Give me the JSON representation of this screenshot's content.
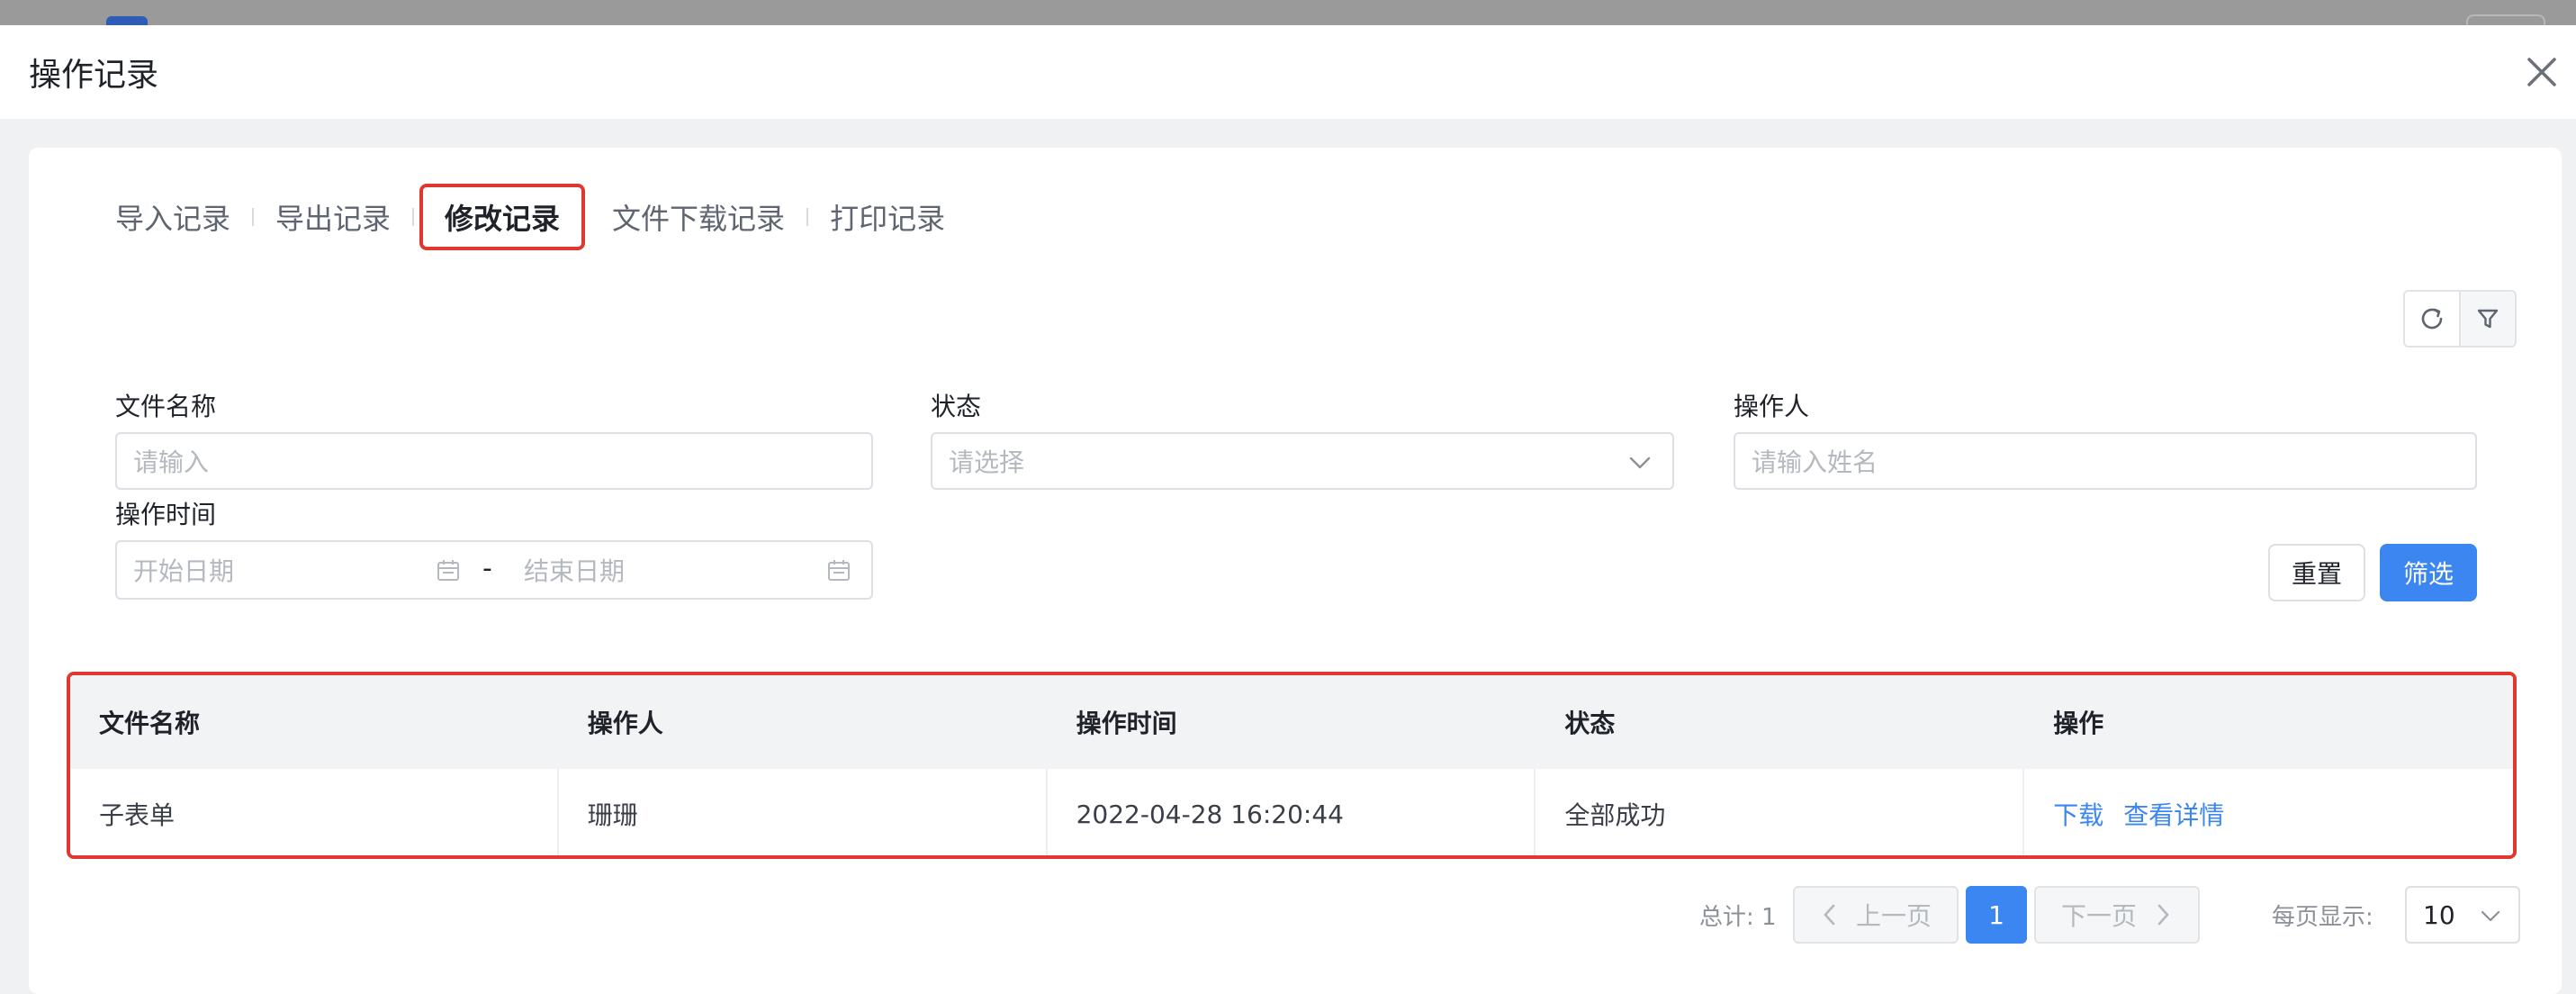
{
  "modal": {
    "title": "操作记录"
  },
  "tabs": [
    {
      "label": "导入记录",
      "active": false
    },
    {
      "label": "导出记录",
      "active": false
    },
    {
      "label": "修改记录",
      "active": true
    },
    {
      "label": "文件下载记录",
      "active": false
    },
    {
      "label": "打印记录",
      "active": false
    }
  ],
  "filters": {
    "file_name": {
      "label": "文件名称",
      "placeholder": "请输入"
    },
    "status": {
      "label": "状态",
      "placeholder": "请选择"
    },
    "operator": {
      "label": "操作人",
      "placeholder": "请输入姓名"
    },
    "time": {
      "label": "操作时间",
      "start_placeholder": "开始日期",
      "end_placeholder": "结束日期",
      "separator": "-"
    },
    "reset_label": "重置",
    "filter_label": "筛选"
  },
  "table": {
    "columns": [
      "文件名称",
      "操作人",
      "操作时间",
      "状态",
      "操作"
    ],
    "rows": [
      {
        "file_name": "子表单",
        "operator": "珊珊",
        "time": "2022-04-28 16:20:44",
        "status": "全部成功",
        "actions": [
          "下载",
          "查看详情"
        ]
      }
    ]
  },
  "pagination": {
    "total_label": "总计: 1",
    "prev_label": "上一页",
    "current_page": "1",
    "next_label": "下一页",
    "page_size_label": "每页显示:",
    "page_size": "10"
  },
  "colors": {
    "accent": "#3b86f0",
    "highlight": "#e0382f"
  },
  "icons": [
    "close-icon",
    "refresh-icon",
    "filter-icon",
    "chevron-down-icon",
    "calendar-icon",
    "chevron-left-icon",
    "chevron-right-icon"
  ]
}
